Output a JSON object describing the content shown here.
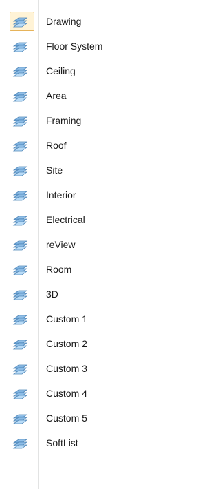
{
  "menu": {
    "items": [
      {
        "label": "Drawing",
        "selected": true
      },
      {
        "label": "Floor System"
      },
      {
        "label": "Ceiling"
      },
      {
        "label": "Area"
      },
      {
        "label": "Framing"
      },
      {
        "label": "Roof"
      },
      {
        "label": "Site"
      },
      {
        "label": "Interior"
      },
      {
        "label": "Electrical"
      },
      {
        "label": "reView"
      },
      {
        "label": "Room"
      },
      {
        "label": "3D"
      },
      {
        "label": "Custom 1"
      },
      {
        "label": "Custom 2"
      },
      {
        "label": "Custom 3"
      },
      {
        "label": "Custom 4"
      },
      {
        "label": "Custom 5"
      },
      {
        "label": "SoftList"
      }
    ],
    "icon": "layer-stack-icon",
    "colors": {
      "icon_blue": "#7fb2dd",
      "icon_blue_dark": "#4f86b8",
      "selected_border": "#e6b35a",
      "selected_fill": "#fff3d6"
    }
  }
}
